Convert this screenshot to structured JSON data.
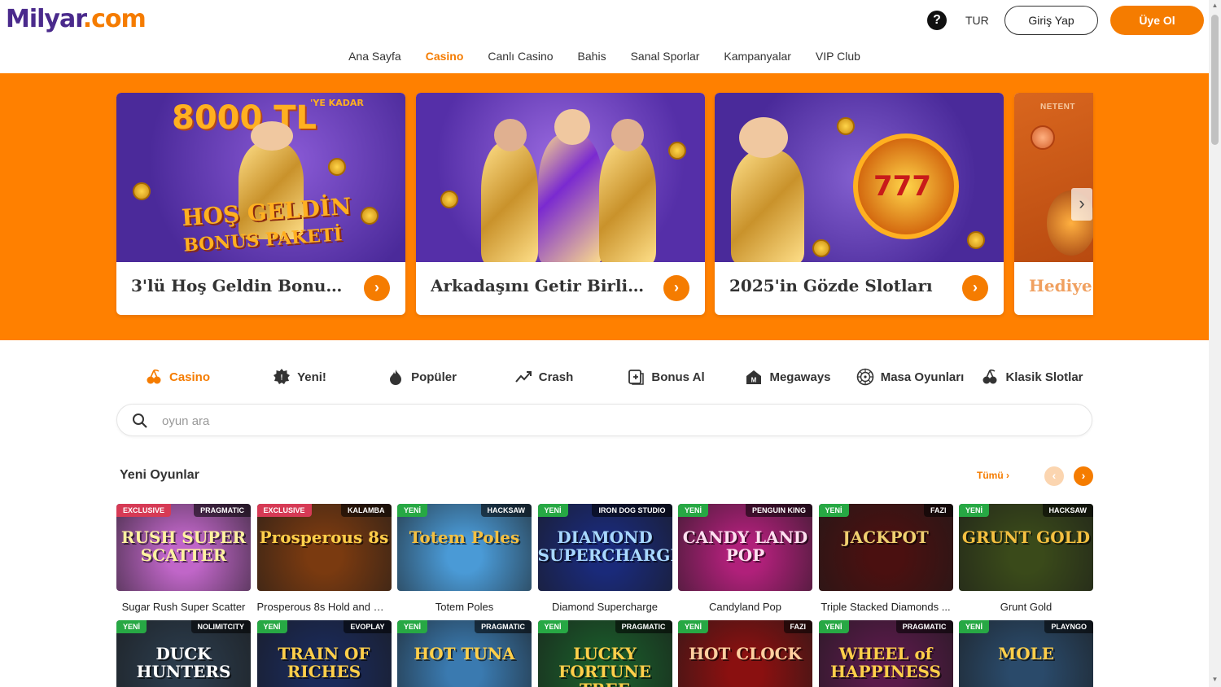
{
  "header": {
    "logo_part1": "Milyar",
    "logo_part2": ".com",
    "help_icon": "?",
    "language": "TUR",
    "login_label": "Giriş Yap",
    "register_label": "Üye Ol"
  },
  "nav": {
    "items": [
      {
        "label": "Ana Sayfa"
      },
      {
        "label": "Casino",
        "active": true
      },
      {
        "label": "Canlı Casino"
      },
      {
        "label": "Bahis"
      },
      {
        "label": "Sanal Sporlar"
      },
      {
        "label": "Kampanyalar"
      },
      {
        "label": "VIP Club"
      }
    ]
  },
  "promos": [
    {
      "title": "3'lü Hoş Geldin Bonusu...",
      "art_big": "8000 TL",
      "art_suffix": "'YE KADAR",
      "art_line1": "HOŞ GELDİN",
      "art_line2": "BONUS PAKETİ"
    },
    {
      "title": "Arkadaşını Getir Birlikte..."
    },
    {
      "title": "2025'in Gözde Slotları"
    },
    {
      "title": "Hediye",
      "brand": "NETENT"
    }
  ],
  "categories": [
    {
      "label": "Casino",
      "icon": "cherries-icon",
      "active": true
    },
    {
      "label": "Yeni!",
      "icon": "new-badge-icon"
    },
    {
      "label": "Popüler",
      "icon": "fire-icon"
    },
    {
      "label": "Crash",
      "icon": "trend-up-icon"
    },
    {
      "label": "Bonus Al",
      "icon": "bonus-buy-icon"
    },
    {
      "label": "Megaways",
      "icon": "megaways-icon"
    },
    {
      "label": "Masa Oyunları",
      "icon": "roulette-icon"
    },
    {
      "label": "Klasik Slotlar",
      "icon": "classic-slot-icon"
    }
  ],
  "search": {
    "placeholder": "oyun ara",
    "value": ""
  },
  "new_games": {
    "title": "Yeni Oyunlar",
    "all_label": "Tümü",
    "prev_icon": "‹",
    "next_icon": "›",
    "games": [
      {
        "name": "Sugar Rush Super Scatter",
        "badge": "EXCLUSIVE",
        "provider": "PRAGMATIC",
        "art": "RUSH SUPER SCATTER",
        "bg": "#c066c8",
        "fg": "#fff3a0"
      },
      {
        "name": "Prosperous 8s Hold and W...",
        "badge": "EXCLUSIVE",
        "provider": "KALAMBA",
        "art": "Prosperous 8s",
        "bg": "#7a3a10",
        "fg": "#ffcf4a"
      },
      {
        "name": "Totem Poles",
        "badge": "YENİ",
        "provider": "HACKSAW",
        "art": "Totem Poles",
        "bg": "#4a9ad6",
        "fg": "#f5c040"
      },
      {
        "name": "Diamond Supercharge",
        "badge": "YENİ",
        "provider": "IRON DOG STUDIO",
        "art": "DIAMOND SUPERCHARGE",
        "bg": "#1a2a7a",
        "fg": "#a8d8ff"
      },
      {
        "name": "Candyland Pop",
        "badge": "YENİ",
        "provider": "PENGUIN KING",
        "art": "CANDY LAND POP",
        "bg": "#b0207a",
        "fg": "#ffe0f0"
      },
      {
        "name": "Triple Stacked Diamonds ...",
        "badge": "YENİ",
        "provider": "FAZI",
        "art": "JACKPOT",
        "bg": "#4a1010",
        "fg": "#f0d070"
      },
      {
        "name": "Grunt Gold",
        "badge": "YENİ",
        "provider": "HACKSAW",
        "art": "GRUNT GOLD",
        "bg": "#3a4a1a",
        "fg": "#f5c040"
      },
      {
        "name": "",
        "badge": "YENİ",
        "provider": "NOLIMITCITY",
        "art": "DUCK HUNTERS",
        "bg": "#2a3a4a",
        "fg": "#ffffff"
      },
      {
        "name": "",
        "badge": "YENİ",
        "provider": "EVOPLAY",
        "art": "TRAIN OF RICHES",
        "bg": "#1a2a5a",
        "fg": "#ffcf4a"
      },
      {
        "name": "",
        "badge": "YENİ",
        "provider": "PRAGMATIC",
        "art": "HOT TUNA",
        "bg": "#3a7ab0",
        "fg": "#ffcf4a"
      },
      {
        "name": "",
        "badge": "YENİ",
        "provider": "PRAGMATIC",
        "art": "LUCKY FORTUNE TREE",
        "bg": "#1a5a2a",
        "fg": "#ffcf4a"
      },
      {
        "name": "",
        "badge": "YENİ",
        "provider": "FAZI",
        "art": "HOT CLOCK",
        "bg": "#8a1010",
        "fg": "#ffd0a0"
      },
      {
        "name": "",
        "badge": "YENİ",
        "provider": "PRAGMATIC",
        "art": "WHEEL of HAPPINESS",
        "bg": "#5a1a4a",
        "fg": "#ffcf4a"
      },
      {
        "name": "",
        "badge": "YENİ",
        "provider": "PLAYNGO",
        "art": "MOLE",
        "bg": "#2a4a6a",
        "fg": "#ffcf4a"
      }
    ]
  }
}
